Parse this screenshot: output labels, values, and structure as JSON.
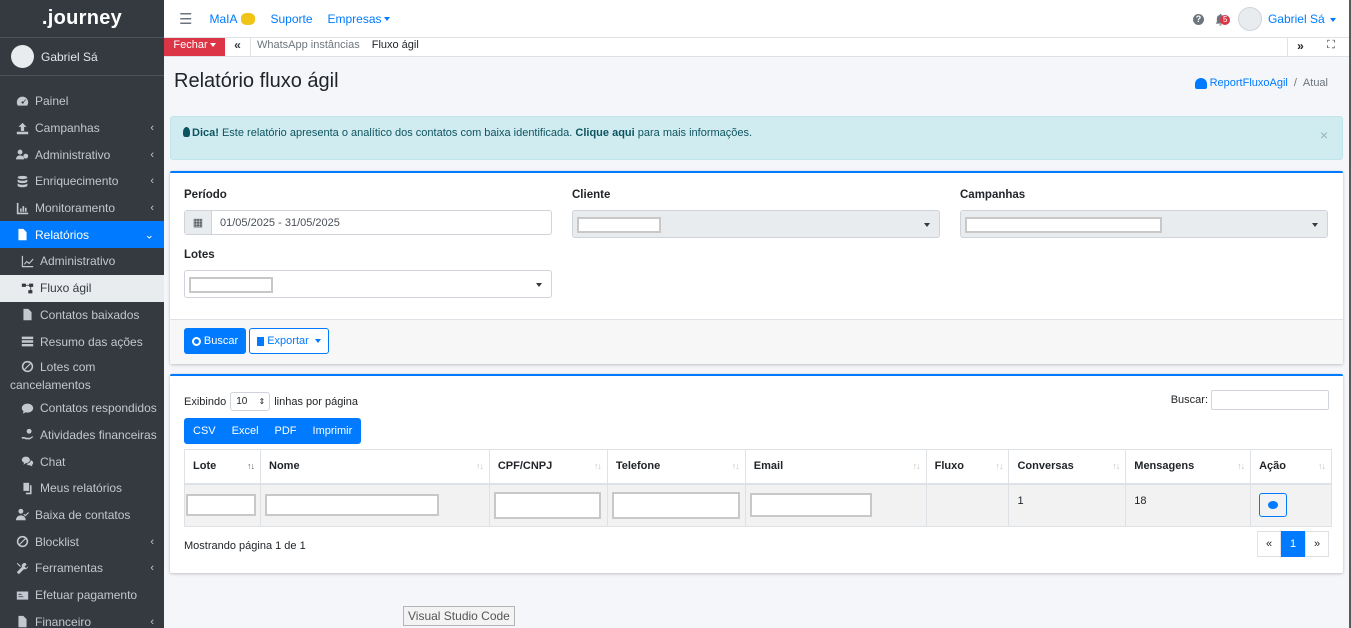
{
  "brand": ".journey",
  "user": {
    "name": "Gabriel Sá"
  },
  "topbar": {
    "links": [
      "MaIA",
      "Suporte",
      "Empresas"
    ],
    "notifications": "5",
    "user_name": "Gabriel Sá"
  },
  "sidebar": {
    "items": [
      {
        "label": "Painel",
        "icon": "gauge-icon"
      },
      {
        "label": "Campanhas",
        "icon": "upload-icon"
      },
      {
        "label": "Administrativo",
        "icon": "users-cog-icon"
      },
      {
        "label": "Enriquecimento",
        "icon": "database-icon"
      },
      {
        "label": "Monitoramento",
        "icon": "chart-icon"
      },
      {
        "label": "Relatórios",
        "icon": "file-icon"
      },
      {
        "label": "Administrativo",
        "icon": "line-chart-icon"
      },
      {
        "label": "Fluxo ágil",
        "icon": "flow-icon"
      },
      {
        "label": "Contatos baixados",
        "icon": "download-file-icon"
      },
      {
        "label": "Resumo das ações",
        "icon": "list-icon"
      },
      {
        "label": "Lotes com",
        "label2": "cancelamentos",
        "icon": "ban-icon"
      },
      {
        "label": "Contatos respondidos",
        "icon": "comment-icon"
      },
      {
        "label": "Atividades financeiras",
        "icon": "hand-coin-icon"
      },
      {
        "label": "Chat",
        "icon": "comments-icon"
      },
      {
        "label": "Meus relatórios",
        "icon": "copy-icon"
      },
      {
        "label": "Baixa de contatos",
        "icon": "user-check-icon"
      },
      {
        "label": "Blocklist",
        "icon": "ban-icon"
      },
      {
        "label": "Ferramentas",
        "icon": "tools-icon"
      },
      {
        "label": "Efetuar pagamento",
        "icon": "card-icon"
      },
      {
        "label": "Financeiro",
        "icon": "file-invoice-icon"
      }
    ]
  },
  "tabs": {
    "close_label": "Fechar",
    "items": [
      "WhatsApp instâncias",
      "Fluxo ágil"
    ]
  },
  "page": {
    "title": "Relatório fluxo ágil",
    "breadcrumb": [
      "ReportFluxoAgil",
      "Atual"
    ]
  },
  "alert": {
    "strong": "Dica!",
    "text": "Este relatório apresenta o analítico dos contatos com baixa identificada.",
    "link": "Clique aqui",
    "tail": "para mais informações.",
    "close": "×"
  },
  "filters": {
    "periodo_label": "Período",
    "periodo_value": "01/05/2025 - 31/05/2025",
    "cliente_label": "Cliente",
    "campanhas_label": "Campanhas",
    "lotes_label": "Lotes",
    "buscar": "Buscar",
    "exportar": "Exportar"
  },
  "table": {
    "show_prefix": "Exibindo",
    "page_length": "10",
    "show_suffix": "linhas por página",
    "search_label": "Buscar:",
    "export_buttons": [
      "CSV",
      "Excel",
      "PDF",
      "Imprimir"
    ],
    "columns": [
      "Lote",
      "Nome",
      "CPF/CNPJ",
      "Telefone",
      "Email",
      "Fluxo",
      "Conversas",
      "Mensagens",
      "Ação"
    ],
    "rows": [
      {
        "conversas": "1",
        "mensagens": "18"
      }
    ],
    "info": "Mostrando página 1 de 1",
    "pager": [
      "«",
      "1",
      "»"
    ]
  },
  "tooltip": "Visual Studio Code",
  "colors": {
    "primary": "#007bff",
    "sidebar": "#343a40",
    "danger": "#dc3545",
    "info_bg": "#d1ecf1"
  }
}
